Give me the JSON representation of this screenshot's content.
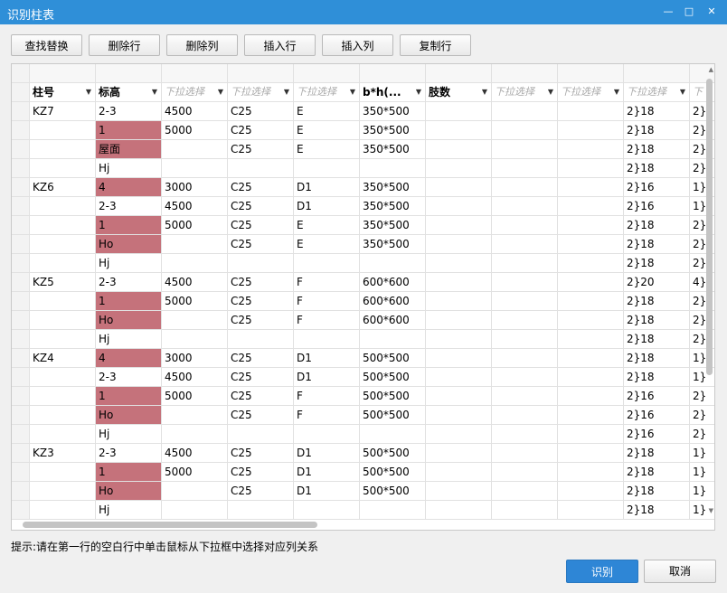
{
  "window": {
    "title": "识别柱表",
    "minimize": "—",
    "maximize": "□",
    "close": "✕"
  },
  "toolbar": [
    {
      "label": "查找替换",
      "name": "find-replace-button"
    },
    {
      "label": "删除行",
      "name": "delete-row-button"
    },
    {
      "label": "删除列",
      "name": "delete-column-button"
    },
    {
      "label": "插入行",
      "name": "insert-row-button"
    },
    {
      "label": "插入列",
      "name": "insert-column-button"
    },
    {
      "label": "复制行",
      "name": "copy-row-button"
    }
  ],
  "grid": {
    "headers": [
      {
        "label": "柱号",
        "style": "bold"
      },
      {
        "label": "标高",
        "style": "bold"
      },
      {
        "label": "下拉选择",
        "style": "hint"
      },
      {
        "label": "下拉选择",
        "style": "hint"
      },
      {
        "label": "下拉选择",
        "style": "hint"
      },
      {
        "label": "b*h(...",
        "style": "bold"
      },
      {
        "label": "肢数",
        "style": "bold"
      },
      {
        "label": "下拉选择",
        "style": "hint"
      },
      {
        "label": "下拉选择",
        "style": "hint"
      },
      {
        "label": "下拉选择",
        "style": "hint"
      },
      {
        "label": "下",
        "style": "hint"
      }
    ],
    "rows": [
      {
        "cells": [
          "KZ7",
          "2-3",
          "4500",
          "C25",
          "E",
          "350*500",
          "",
          "",
          "",
          "2}18",
          "2}"
        ],
        "pink": false
      },
      {
        "cells": [
          "",
          "1",
          "5000",
          "C25",
          "E",
          "350*500",
          "",
          "",
          "",
          "2}18",
          "2}"
        ],
        "pink": true
      },
      {
        "cells": [
          "",
          "屋面",
          "",
          "C25",
          "E",
          "350*500",
          "",
          "",
          "",
          "2}18",
          "2}"
        ],
        "pink": true
      },
      {
        "cells": [
          "",
          "Hj",
          "",
          "",
          "",
          "",
          "",
          "",
          "",
          "2}18",
          "2}"
        ],
        "pink": false
      },
      {
        "cells": [
          "KZ6",
          "4",
          "3000",
          "C25",
          "D1",
          "350*500",
          "",
          "",
          "",
          "2}16",
          "1}"
        ],
        "pink": true
      },
      {
        "cells": [
          "",
          "2-3",
          "4500",
          "C25",
          "D1",
          "350*500",
          "",
          "",
          "",
          "2}16",
          "1}"
        ],
        "pink": false
      },
      {
        "cells": [
          "",
          "1",
          "5000",
          "C25",
          "E",
          "350*500",
          "",
          "",
          "",
          "2}18",
          "2}"
        ],
        "pink": true
      },
      {
        "cells": [
          "",
          "Ho",
          "",
          "C25",
          "E",
          "350*500",
          "",
          "",
          "",
          "2}18",
          "2}"
        ],
        "pink": true
      },
      {
        "cells": [
          "",
          "Hj",
          "",
          "",
          "",
          "",
          "",
          "",
          "",
          "2}18",
          "2}"
        ],
        "pink": false
      },
      {
        "cells": [
          "KZ5",
          "2-3",
          "4500",
          "C25",
          "F",
          "600*600",
          "",
          "",
          "",
          "2}20",
          "4}"
        ],
        "pink": false
      },
      {
        "cells": [
          "",
          "1",
          "5000",
          "C25",
          "F",
          "600*600",
          "",
          "",
          "",
          "2}18",
          "2}"
        ],
        "pink": true
      },
      {
        "cells": [
          "",
          "Ho",
          "",
          "C25",
          "F",
          "600*600",
          "",
          "",
          "",
          "2}18",
          "2}"
        ],
        "pink": true
      },
      {
        "cells": [
          "",
          "Hj",
          "",
          "",
          "",
          "",
          "",
          "",
          "",
          "2}18",
          "2}"
        ],
        "pink": false
      },
      {
        "cells": [
          "KZ4",
          "4",
          "3000",
          "C25",
          "D1",
          "500*500",
          "",
          "",
          "",
          "2}18",
          "1}"
        ],
        "pink": true
      },
      {
        "cells": [
          "",
          "2-3",
          "4500",
          "C25",
          "D1",
          "500*500",
          "",
          "",
          "",
          "2}18",
          "1}"
        ],
        "pink": false
      },
      {
        "cells": [
          "",
          "1",
          "5000",
          "C25",
          "F",
          "500*500",
          "",
          "",
          "",
          "2}16",
          "2}"
        ],
        "pink": true
      },
      {
        "cells": [
          "",
          "Ho",
          "",
          "C25",
          "F",
          "500*500",
          "",
          "",
          "",
          "2}16",
          "2}"
        ],
        "pink": true
      },
      {
        "cells": [
          "",
          "Hj",
          "",
          "",
          "",
          "",
          "",
          "",
          "",
          "2}16",
          "2}"
        ],
        "pink": false
      },
      {
        "cells": [
          "KZ3",
          "2-3",
          "4500",
          "C25",
          "D1",
          "500*500",
          "",
          "",
          "",
          "2}18",
          "1}"
        ],
        "pink": false
      },
      {
        "cells": [
          "",
          "1",
          "5000",
          "C25",
          "D1",
          "500*500",
          "",
          "",
          "",
          "2}18",
          "1}"
        ],
        "pink": true
      },
      {
        "cells": [
          "",
          "Ho",
          "",
          "C25",
          "D1",
          "500*500",
          "",
          "",
          "",
          "2}18",
          "1}"
        ],
        "pink": true
      },
      {
        "cells": [
          "",
          "Hj",
          "",
          "",
          "",
          "",
          "",
          "",
          "",
          "2}18",
          "1}"
        ],
        "pink": false
      }
    ],
    "colors": {
      "highlight": "#c5727b"
    }
  },
  "hint": "提示:请在第一行的空白行中单击鼠标从下拉框中选择对应列关系",
  "buttons": {
    "recognize": "识别",
    "cancel": "取消"
  }
}
